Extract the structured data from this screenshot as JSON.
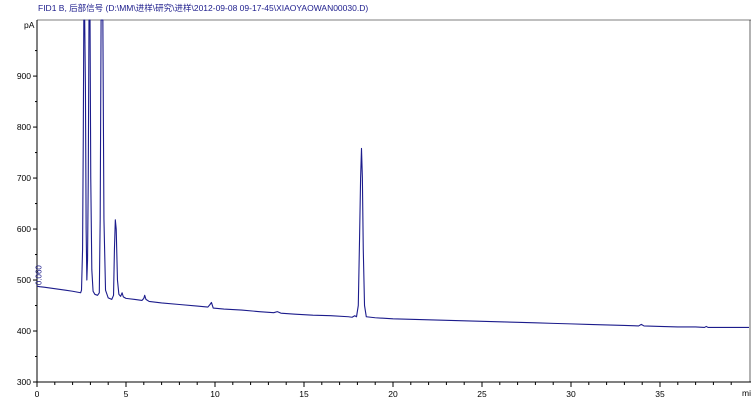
{
  "chart_data": {
    "type": "line",
    "title": "FID1 B, 后部信号 (D:\\MM\\进样\\研究\\进样\\2012-09-08 09-17-45\\XIAOYAOWAN00030.D)",
    "xlabel": "min",
    "ylabel": "pA",
    "xlim": [
      0,
      40
    ],
    "ylim": [
      300,
      1010
    ],
    "x_ticks": [
      0,
      5,
      10,
      15,
      20,
      25,
      30,
      35
    ],
    "y_ticks": [
      300,
      400,
      500,
      600,
      700,
      800,
      900
    ],
    "grid": false,
    "annotations": [
      {
        "text": "0.060",
        "x": 0.25,
        "y": 490
      }
    ],
    "series": [
      {
        "color": "#1c1c8c",
        "points": [
          [
            0.0,
            488
          ],
          [
            0.15,
            487
          ],
          [
            0.4,
            486
          ],
          [
            0.8,
            484
          ],
          [
            1.2,
            482
          ],
          [
            1.6,
            480
          ],
          [
            2.0,
            478
          ],
          [
            2.3,
            476
          ],
          [
            2.45,
            475
          ],
          [
            2.5,
            480
          ],
          [
            2.56,
            560
          ],
          [
            2.6,
            780
          ],
          [
            2.63,
            1010
          ],
          [
            2.68,
            1010
          ],
          [
            2.72,
            880
          ],
          [
            2.76,
            600
          ],
          [
            2.8,
            500
          ],
          [
            2.84,
            540
          ],
          [
            2.88,
            700
          ],
          [
            2.92,
            1010
          ],
          [
            2.98,
            1010
          ],
          [
            3.02,
            700
          ],
          [
            3.08,
            520
          ],
          [
            3.15,
            478
          ],
          [
            3.25,
            472
          ],
          [
            3.4,
            470
          ],
          [
            3.5,
            475
          ],
          [
            3.55,
            620
          ],
          [
            3.6,
            1010
          ],
          [
            3.7,
            1010
          ],
          [
            3.76,
            620
          ],
          [
            3.85,
            480
          ],
          [
            4.0,
            465
          ],
          [
            4.2,
            462
          ],
          [
            4.3,
            470
          ],
          [
            4.35,
            560
          ],
          [
            4.4,
            618
          ],
          [
            4.45,
            600
          ],
          [
            4.52,
            500
          ],
          [
            4.6,
            472
          ],
          [
            4.7,
            468
          ],
          [
            4.78,
            475
          ],
          [
            4.85,
            467
          ],
          [
            5.0,
            464
          ],
          [
            5.5,
            462
          ],
          [
            5.9,
            460
          ],
          [
            6.0,
            464
          ],
          [
            6.05,
            470
          ],
          [
            6.12,
            462
          ],
          [
            6.3,
            458
          ],
          [
            7.0,
            455
          ],
          [
            8.0,
            452
          ],
          [
            9.0,
            449
          ],
          [
            9.6,
            447
          ],
          [
            9.72,
            452
          ],
          [
            9.8,
            456
          ],
          [
            9.9,
            445
          ],
          [
            10.5,
            443
          ],
          [
            11.5,
            441
          ],
          [
            12.5,
            438
          ],
          [
            13.3,
            436
          ],
          [
            13.5,
            438
          ],
          [
            13.7,
            435
          ],
          [
            14.5,
            433
          ],
          [
            15.5,
            431
          ],
          [
            16.5,
            430
          ],
          [
            17.5,
            428
          ],
          [
            17.7,
            427
          ],
          [
            17.85,
            430
          ],
          [
            17.95,
            428
          ],
          [
            18.05,
            450
          ],
          [
            18.12,
            580
          ],
          [
            18.18,
            700
          ],
          [
            18.23,
            758
          ],
          [
            18.28,
            700
          ],
          [
            18.33,
            560
          ],
          [
            18.4,
            450
          ],
          [
            18.5,
            428
          ],
          [
            19.0,
            426
          ],
          [
            20.0,
            424
          ],
          [
            21.0,
            423
          ],
          [
            22.0,
            422
          ],
          [
            23.0,
            421
          ],
          [
            24.0,
            420
          ],
          [
            25.0,
            419
          ],
          [
            26.0,
            418
          ],
          [
            27.0,
            417
          ],
          [
            28.0,
            416
          ],
          [
            29.0,
            415
          ],
          [
            30.0,
            414
          ],
          [
            31.0,
            413
          ],
          [
            32.0,
            412
          ],
          [
            33.0,
            411
          ],
          [
            33.8,
            410
          ],
          [
            33.95,
            413
          ],
          [
            34.1,
            410
          ],
          [
            35.0,
            409
          ],
          [
            36.0,
            408
          ],
          [
            37.0,
            408
          ],
          [
            37.5,
            407
          ],
          [
            37.6,
            409
          ],
          [
            37.7,
            407
          ],
          [
            38.5,
            407
          ],
          [
            39.5,
            407
          ],
          [
            40.0,
            407
          ]
        ]
      }
    ]
  }
}
